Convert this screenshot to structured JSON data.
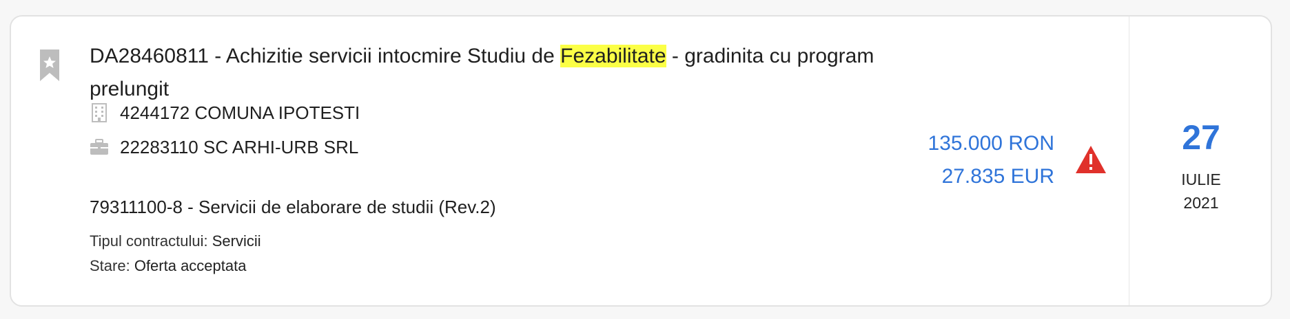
{
  "tender": {
    "title_prefix": "DA28460811 - Achizitie servicii intocmire Studiu de ",
    "title_highlight": "Fezabilitate",
    "title_suffix": " - gradinita cu program prelungit",
    "authority": "4244172 COMUNA IPOTESTI",
    "supplier": "22283110 SC ARHI-URB SRL",
    "cpv": "79311100-8 - Servicii de elaborare de studii (Rev.2)",
    "contract_type_label": "Tipul contractului:",
    "contract_type_value": "Servicii",
    "status_label": "Stare:",
    "status_value": "Oferta acceptata",
    "value_ron": "135.000 RON",
    "value_eur": "27.835 EUR",
    "date_day": "27",
    "date_month": "IULIE",
    "date_year": "2021"
  },
  "icons": {
    "bookmark": "bookmark-star-icon",
    "authority": "building-icon",
    "supplier": "briefcase-icon",
    "warning": "warning-triangle-icon"
  },
  "colors": {
    "accent": "#2f74d9",
    "highlight": "#fbff46",
    "warning": "#e0312b",
    "icon_gray": "#bdbdbd"
  }
}
